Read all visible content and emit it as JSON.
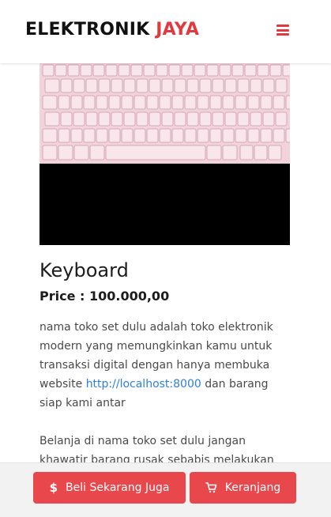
{
  "header": {
    "brand_main": "ELEKTRONIK",
    "brand_accent": "JAYA",
    "menu_icon": "hamburger-menu-icon",
    "accent_color": "#e03a3e"
  },
  "product": {
    "image_desc": "keyboard-image",
    "name": "Keyboard",
    "price": "Price : 100.000,00"
  },
  "description": {
    "p1_before_link": "nama toko set dulu adalah toko elektronik modern yang memungkinkan kamu untuk transaksi digital dengan hanya membuka website ",
    "p1_link": "http://localhost:8000",
    "p1_after_link": " dan barang siap kami antar",
    "p2": "Belanja di nama toko set dulu jangan khawatir barang rusak sebabis melakukan"
  },
  "footer": {
    "buy_icon": "dollar-icon",
    "buy_label": "Beli Sekarang Juga",
    "cart_icon": "shopping-cart-icon",
    "cart_label": "Keranjang",
    "button_color": "#e8474b"
  }
}
